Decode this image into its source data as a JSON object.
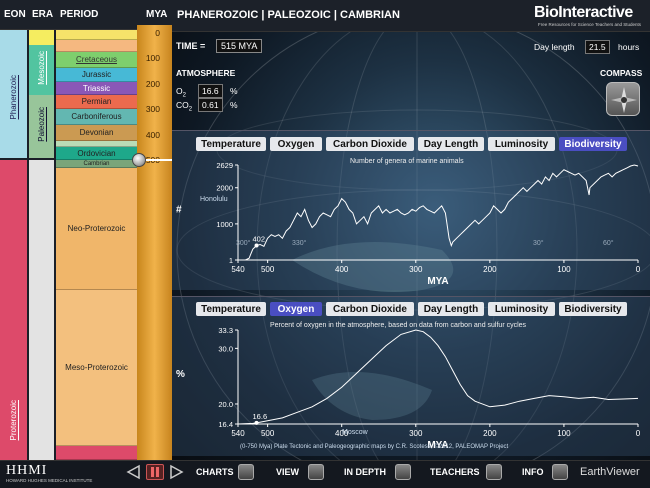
{
  "timeline": {
    "headers": {
      "eon": "EON",
      "era": "ERA",
      "period": "PERIOD",
      "mya": "MYA"
    },
    "eons": [
      "Phanerozoic",
      "Proterozoic"
    ],
    "eras": [
      "Mesozoic",
      "Paleozoic"
    ],
    "periods": {
      "cretaceous": "Cretaceous",
      "jurassic": "Jurassic",
      "triassic": "Triassic",
      "permian": "Permian",
      "carboniferous": "Carboniferous",
      "devonian": "Devonian",
      "ordovician": "Ordovician",
      "cambrian": "Cambrian",
      "neo": "Neo-Proterozoic",
      "meso": "Meso-Proterozoic"
    },
    "ticks": [
      "0",
      "100",
      "200",
      "300",
      "400",
      "500"
    ]
  },
  "header": {
    "title": "PHANEROZOIC | PALEOZOIC | CAMBRIAN",
    "logo": "BioInteractive",
    "tagline": "Free Resources for Science Teachers and Students"
  },
  "time": {
    "label": "TIME =",
    "value": "515 MYA"
  },
  "daylength": {
    "label": "Day length",
    "value": "21.5",
    "unit": "hours"
  },
  "atmosphere": {
    "title": "ATMOSPHERE",
    "o2_label": "O",
    "o2_sub": "2",
    "o2_value": "16.6",
    "co2_label": "CO",
    "co2_sub": "2",
    "co2_value": "0.61",
    "unit": "%"
  },
  "compass_label": "COMPASS",
  "tabs": [
    "Temperature",
    "Oxygen",
    "Carbon Dioxide",
    "Day Length",
    "Luminosity",
    "Biodiversity"
  ],
  "top_chart_selected": "Biodiversity",
  "bottom_chart_selected": "Oxygen",
  "map_labels": {
    "honolulu": "Honolulu",
    "moscow": "Moscow",
    "lon300": "300°",
    "lon330": "330°",
    "lon30": "30°",
    "lon60": "60°"
  },
  "credit": "(0-750 Mya) Plate Tectonic and Paleogeographic maps by C.R. Scotese, ©2012, PALEOMAP Project",
  "chart_data": [
    {
      "type": "line",
      "title": "Number of genera of marine animals",
      "xlabel": "MYA",
      "ylabel": "#",
      "x_ticks": [
        "540",
        "500",
        "400",
        "300",
        "200",
        "100",
        "0"
      ],
      "y_ticks": [
        "2629",
        "2000",
        "1000",
        "1"
      ],
      "xlim": [
        540,
        0
      ],
      "ylim": [
        1,
        2629
      ],
      "annotation": {
        "x": 515,
        "y": 402,
        "label": "402"
      },
      "x": [
        540,
        535,
        530,
        525,
        520,
        515,
        512,
        510,
        505,
        500,
        495,
        490,
        485,
        480,
        475,
        470,
        465,
        460,
        455,
        450,
        445,
        440,
        435,
        430,
        425,
        420,
        415,
        410,
        405,
        400,
        395,
        390,
        385,
        380,
        375,
        370,
        365,
        360,
        355,
        350,
        345,
        340,
        335,
        330,
        325,
        320,
        315,
        310,
        305,
        300,
        295,
        290,
        285,
        280,
        275,
        270,
        265,
        260,
        255,
        252,
        250,
        245,
        240,
        235,
        230,
        225,
        220,
        215,
        210,
        205,
        200,
        195,
        190,
        185,
        180,
        175,
        170,
        165,
        160,
        155,
        150,
        145,
        140,
        135,
        130,
        125,
        120,
        115,
        110,
        105,
        100,
        95,
        90,
        85,
        80,
        75,
        70,
        66,
        65,
        60,
        55,
        50,
        45,
        40,
        35,
        30,
        25,
        20,
        15,
        10,
        5,
        0
      ],
      "y": [
        1,
        1,
        1,
        50,
        300,
        402,
        420,
        430,
        380,
        600,
        700,
        650,
        700,
        600,
        800,
        900,
        1100,
        1300,
        1200,
        1400,
        1100,
        900,
        1000,
        1200,
        1300,
        1250,
        1200,
        1400,
        1500,
        1700,
        1600,
        1400,
        1300,
        1000,
        1100,
        1200,
        1000,
        1300,
        1400,
        1500,
        1300,
        1400,
        1300,
        1350,
        1400,
        1300,
        1250,
        1300,
        1400,
        1350,
        1450,
        1500,
        1400,
        1350,
        1300,
        1400,
        1500,
        1300,
        600,
        400,
        500,
        600,
        700,
        800,
        900,
        1000,
        1100,
        1000,
        1100,
        1200,
        1300,
        1500,
        1400,
        1300,
        1400,
        1600,
        1700,
        1800,
        1900,
        2000,
        1900,
        2000,
        2100,
        2200,
        2100,
        2300,
        2200,
        2400,
        2300,
        2400,
        2500,
        2450,
        2400,
        2350,
        2400,
        2300,
        2200,
        1800,
        2000,
        2100,
        2200,
        2300,
        2350,
        2400,
        2300,
        2400,
        2450,
        2500,
        2550,
        2600,
        2629,
        2600
      ]
    },
    {
      "type": "line",
      "title": "Percent of oxygen in the atmosphere, based on data from carbon and sulfur cycles",
      "xlabel": "MYA",
      "ylabel": "%",
      "x_ticks": [
        "540",
        "500",
        "400",
        "300",
        "200",
        "100",
        "0"
      ],
      "y_ticks": [
        "33.3",
        "30.0",
        "20.0",
        "16.4"
      ],
      "xlim": [
        540,
        0
      ],
      "ylim": [
        16.4,
        33.3
      ],
      "annotation": {
        "x": 515,
        "y": 16.6,
        "label": "16.6"
      },
      "x": [
        540,
        520,
        515,
        500,
        480,
        460,
        440,
        420,
        400,
        380,
        360,
        340,
        320,
        300,
        290,
        280,
        270,
        260,
        250,
        240,
        230,
        220,
        200,
        180,
        160,
        140,
        120,
        100,
        80,
        60,
        40,
        20,
        0
      ],
      "y": [
        16.4,
        16.5,
        16.6,
        17.0,
        17.5,
        18.5,
        19.5,
        21.0,
        23.0,
        25.5,
        28.0,
        30.5,
        32.5,
        33.3,
        33.0,
        32.0,
        30.5,
        28.5,
        26.0,
        23.5,
        21.5,
        20.5,
        19.5,
        19.8,
        20.5,
        21.0,
        21.5,
        21.3,
        21.0,
        21.2,
        20.8,
        20.9,
        21.0
      ]
    }
  ],
  "bottom_nav": {
    "hhmi": "HHMI",
    "hhmi_sub": "HOWARD HUGHES MEDICAL INSTITUTE",
    "charts": "CHARTS",
    "view": "VIEW",
    "indepth": "IN DEPTH",
    "teachers": "TEACHERS",
    "info": "INFO",
    "app": "EarthViewer"
  }
}
